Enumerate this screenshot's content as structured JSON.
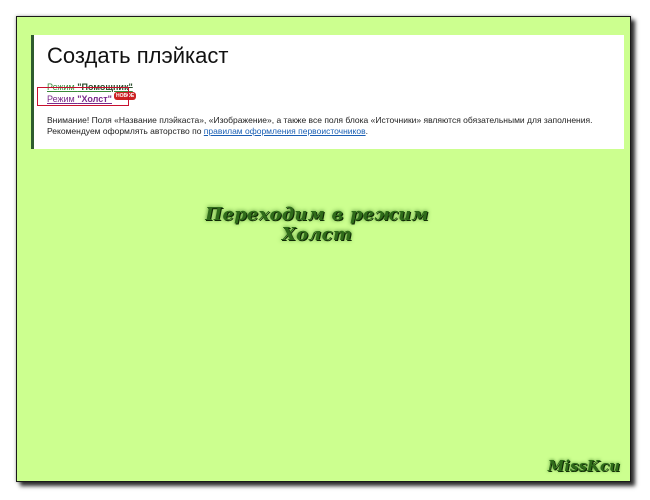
{
  "panel": {
    "title": "Создать плэйкаст",
    "modes": [
      {
        "prefix": "Режим ",
        "name": "\"Помощник\""
      },
      {
        "prefix": "Режим ",
        "name": "\"Холст\"",
        "badge": "НОВОЕ"
      }
    ],
    "notice": {
      "line1": "Внимание! Поля «Название плэйкаста», «Изображение», а также все поля блока «Источники» являются обязательными для заполнения.",
      "line2_prefix": "Рекомендуем оформлять авторство по ",
      "line2_link": "правилам оформления первоисточников",
      "line2_suffix": "."
    }
  },
  "caption": {
    "line1": "Переходим в режим",
    "line2": "Холст"
  },
  "signature": "MissKcu",
  "colors": {
    "background": "#ccff8f",
    "highlight": "#c8102e",
    "link": "#1a5fb4",
    "caption": "#2f6b1a"
  }
}
